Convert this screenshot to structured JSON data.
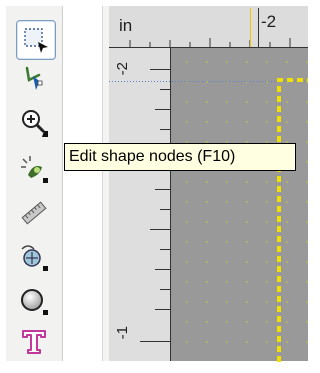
{
  "ruler": {
    "unit": "in",
    "top_label": "-2",
    "left_label_top": "-2",
    "left_label_bottom": "-1"
  },
  "tooltip": {
    "text": "Edit shape nodes (F10)"
  },
  "tools": [
    {
      "name": "selector-tool",
      "icon": "selector-icon",
      "active": true
    },
    {
      "name": "node-tool",
      "icon": "node-edit-icon",
      "active": false
    },
    {
      "name": "zoom-tool",
      "icon": "zoom-icon",
      "active": false
    },
    {
      "name": "tweak-tool",
      "icon": "tweak-icon",
      "active": false
    },
    {
      "name": "measure-tool",
      "icon": "ruler-icon",
      "active": false
    },
    {
      "name": "spray-tool",
      "icon": "spray-icon",
      "active": false
    },
    {
      "name": "ellipse-tool",
      "icon": "ellipse-icon",
      "active": false
    },
    {
      "name": "text-tool",
      "icon": "text-icon",
      "active": false
    }
  ],
  "colors": {
    "guide": "#f0c800",
    "canvas": "#999999",
    "tooltip_bg": "#ffffe1",
    "text_tool": "#c2389a"
  }
}
